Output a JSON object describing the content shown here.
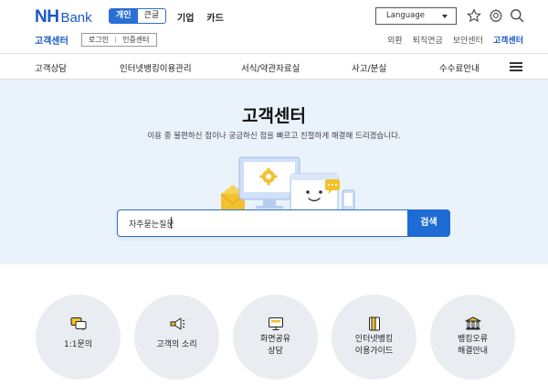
{
  "brand": {
    "nh": "NH",
    "bank": "Bank"
  },
  "segment_tabs": [
    {
      "label": "개인",
      "active": true
    },
    {
      "label": "큰글",
      "active": false
    }
  ],
  "top_nav": [
    "기업",
    "카드"
  ],
  "language": {
    "label": "Language"
  },
  "top_icons": [
    "star-icon",
    "gear-icon",
    "search-icon"
  ],
  "subheader": {
    "title": "고객센터",
    "login": "로그인",
    "cert": "인증센터",
    "links": [
      {
        "label": "외환",
        "active": false
      },
      {
        "label": "퇴직연금",
        "active": false
      },
      {
        "label": "보안센터",
        "active": false
      },
      {
        "label": "고객센터",
        "active": true
      }
    ]
  },
  "menu": [
    "고객상담",
    "인터넷뱅킹이용관리",
    "서식/약관자료실",
    "사고/분실",
    "수수료안내"
  ],
  "hero": {
    "title": "고객센터",
    "subtitle": "이용 중 불편하신 점이나 궁금하신 점을 빠르고 친절하게 해결해 드리겠습니다.",
    "search_placeholder": "자주묻는질문",
    "search_button": "검색"
  },
  "services": [
    {
      "icon": "chat-bubbles-icon",
      "line1": "1:1문의",
      "line2": ""
    },
    {
      "icon": "megaphone-icon",
      "line1": "고객의 소리",
      "line2": ""
    },
    {
      "icon": "screen-share-icon",
      "line1": "화면공유",
      "line2": "상담"
    },
    {
      "icon": "guide-book-icon",
      "line1": "인터넷뱅킹",
      "line2": "이용가이드"
    },
    {
      "icon": "bank-building-icon",
      "line1": "뱅킹오류",
      "line2": "해결안내"
    }
  ],
  "colors": {
    "brand_blue": "#1a57c8",
    "button_blue": "#1f6bd6",
    "hero_bg": "#eaf2fb",
    "circle_bg": "#e9edf2",
    "icon_yellow": "#f2c12e"
  }
}
